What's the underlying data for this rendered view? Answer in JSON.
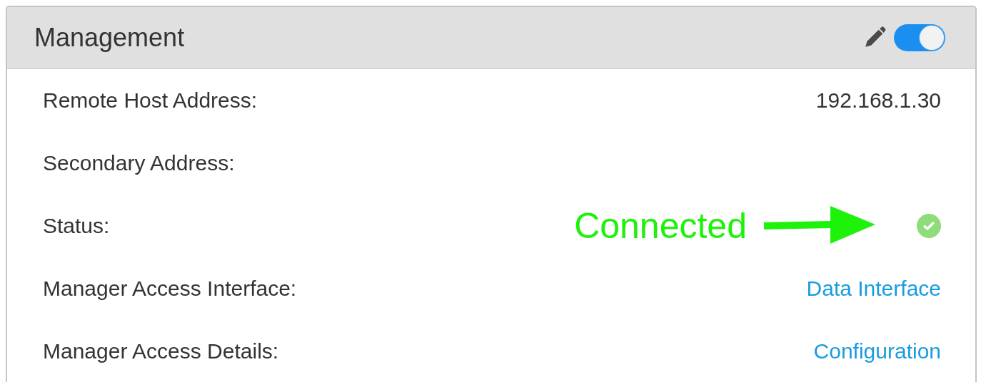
{
  "panel": {
    "title": "Management",
    "edit_icon": true,
    "enabled": {
      "on": true
    }
  },
  "rows": [
    {
      "kind": "text",
      "label": "Remote Host Address:",
      "value": "192.168.1.30"
    },
    {
      "kind": "text",
      "label": "Secondary Address:"
    },
    {
      "kind": "status",
      "label": "Status:",
      "ok": true,
      "annotation": "Connected"
    },
    {
      "kind": "link",
      "label": "Manager Access Interface:",
      "value": "Data Interface"
    },
    {
      "kind": "link",
      "label": "Manager Access Details:",
      "value": "Configuration"
    }
  ]
}
